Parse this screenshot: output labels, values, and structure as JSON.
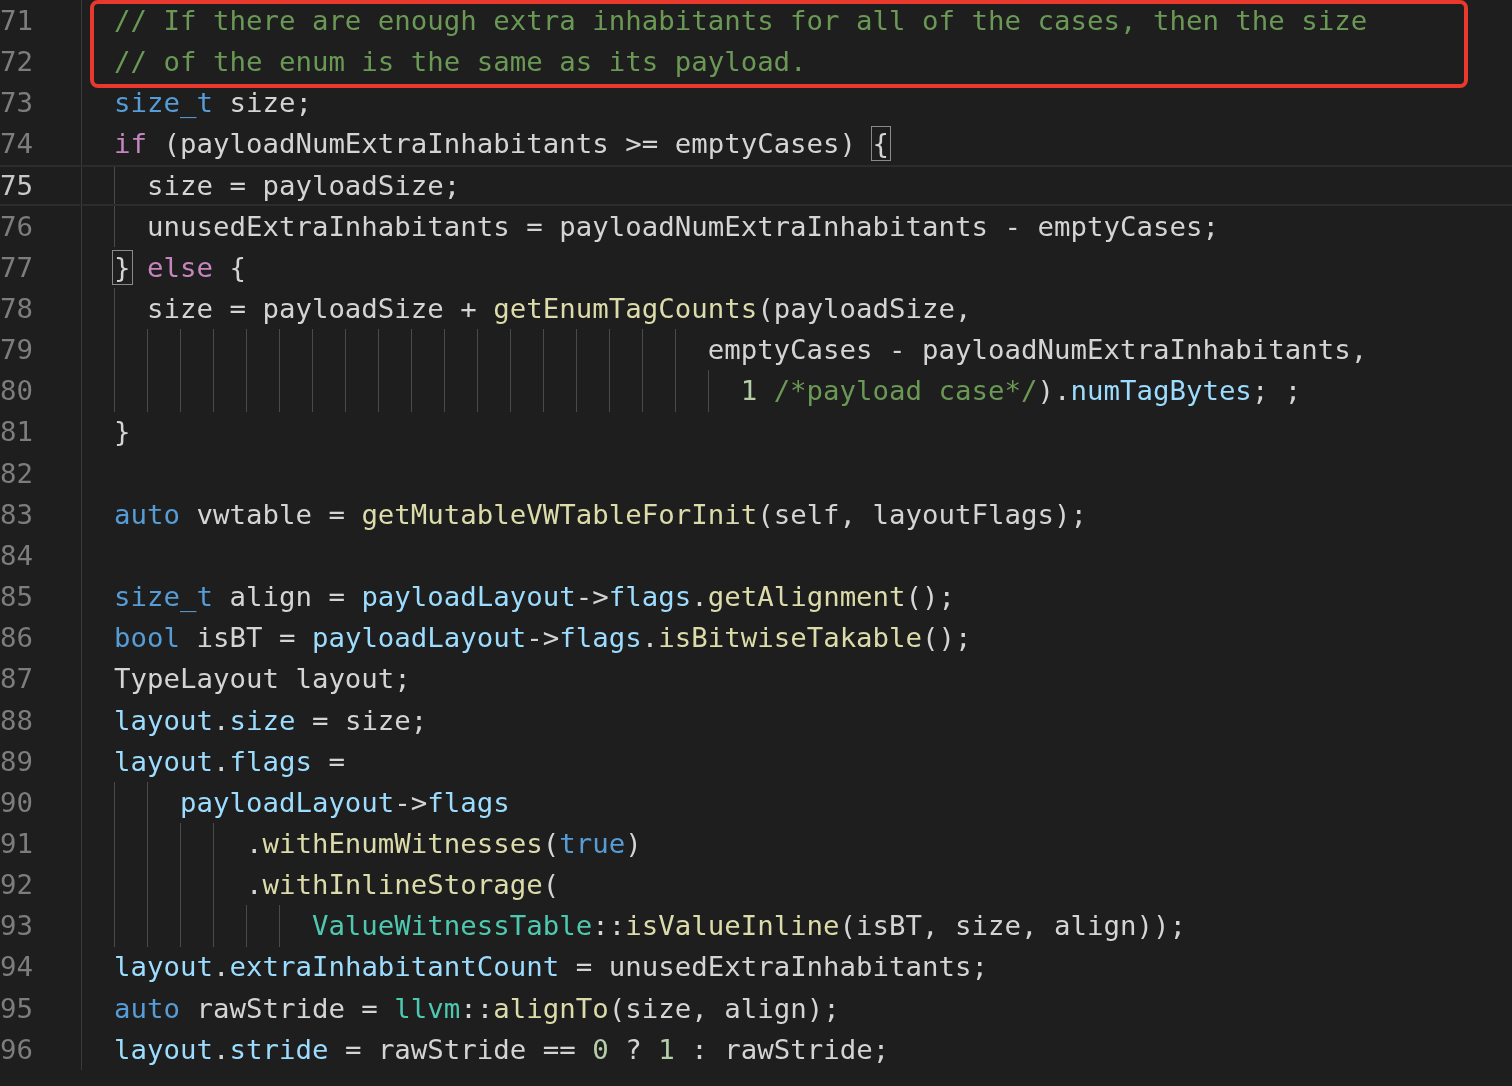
{
  "editor": {
    "lines": [
      {
        "number": "71",
        "current": false,
        "tokens": [
          {
            "kind": "comment",
            "text": "// If there are enough extra inhabitants for all of the cases, then the size"
          }
        ]
      },
      {
        "number": "72",
        "current": false,
        "tokens": [
          {
            "kind": "comment",
            "text": "// of the enum is the same as its payload."
          }
        ]
      },
      {
        "number": "73",
        "current": false,
        "tokens": [
          {
            "kind": "type",
            "text": "size_t"
          },
          {
            "kind": "plain",
            "text": " size;"
          }
        ]
      },
      {
        "number": "74",
        "current": false,
        "tokens": [
          {
            "kind": "keyword",
            "text": "if"
          },
          {
            "kind": "plain",
            "text": " (payloadNumExtraInhabitants >= emptyCases) "
          },
          {
            "kind": "bracket-match",
            "text": "{"
          }
        ]
      },
      {
        "number": "75",
        "current": true,
        "tokens": [
          {
            "kind": "plain",
            "text": "  size = payloadSize;"
          }
        ]
      },
      {
        "number": "76",
        "current": false,
        "tokens": [
          {
            "kind": "plain",
            "text": "  unusedExtraInhabitants = payloadNumExtraInhabitants - emptyCases;"
          }
        ]
      },
      {
        "number": "77",
        "current": false,
        "tokens": [
          {
            "kind": "bracket-match",
            "text": "}"
          },
          {
            "kind": "keyword",
            "text": " else"
          },
          {
            "kind": "plain",
            "text": " {"
          }
        ]
      },
      {
        "number": "78",
        "current": false,
        "tokens": [
          {
            "kind": "plain",
            "text": "  size = payloadSize + "
          },
          {
            "kind": "function",
            "text": "getEnumTagCounts"
          },
          {
            "kind": "plain",
            "text": "(payloadSize,"
          }
        ]
      },
      {
        "number": "79",
        "current": false,
        "tokens": [
          {
            "kind": "plain",
            "text": "                                    emptyCases - payloadNumExtraInhabitants,"
          }
        ]
      },
      {
        "number": "80",
        "current": false,
        "tokens": [
          {
            "kind": "number",
            "text": "                                      1"
          },
          {
            "kind": "comment",
            "text": " /*payload case*/"
          },
          {
            "kind": "plain",
            "text": ")."
          },
          {
            "kind": "variable",
            "text": "numTagBytes"
          },
          {
            "kind": "plain",
            "text": "; ;"
          }
        ]
      },
      {
        "number": "81",
        "current": false,
        "tokens": [
          {
            "kind": "plain",
            "text": "}"
          }
        ]
      },
      {
        "number": "82",
        "current": false
      },
      {
        "number": "83",
        "current": false,
        "tokens": [
          {
            "kind": "type",
            "text": "auto"
          },
          {
            "kind": "plain",
            "text": " vwtable = "
          },
          {
            "kind": "function",
            "text": "getMutableVWTableForInit"
          },
          {
            "kind": "plain",
            "text": "(self, layoutFlags);"
          }
        ]
      },
      {
        "number": "84",
        "current": false
      },
      {
        "number": "85",
        "current": false,
        "tokens": [
          {
            "kind": "type",
            "text": "size_t"
          },
          {
            "kind": "plain",
            "text": " align = "
          },
          {
            "kind": "variable",
            "text": "payloadLayout"
          },
          {
            "kind": "plain",
            "text": "->"
          },
          {
            "kind": "variable",
            "text": "flags"
          },
          {
            "kind": "plain",
            "text": "."
          },
          {
            "kind": "function",
            "text": "getAlignment"
          },
          {
            "kind": "plain",
            "text": "();"
          }
        ]
      },
      {
        "number": "86",
        "current": false,
        "tokens": [
          {
            "kind": "type",
            "text": "bool"
          },
          {
            "kind": "plain",
            "text": " isBT = "
          },
          {
            "kind": "variable",
            "text": "payloadLayout"
          },
          {
            "kind": "plain",
            "text": "->"
          },
          {
            "kind": "variable",
            "text": "flags"
          },
          {
            "kind": "plain",
            "text": "."
          },
          {
            "kind": "function",
            "text": "isBitwiseTakable"
          },
          {
            "kind": "plain",
            "text": "();"
          }
        ]
      },
      {
        "number": "87",
        "current": false,
        "tokens": [
          {
            "kind": "plain",
            "text": "TypeLayout layout;"
          }
        ]
      },
      {
        "number": "88",
        "current": false,
        "tokens": [
          {
            "kind": "variable",
            "text": "layout"
          },
          {
            "kind": "plain",
            "text": "."
          },
          {
            "kind": "variable",
            "text": "size"
          },
          {
            "kind": "plain",
            "text": " = size;"
          }
        ]
      },
      {
        "number": "89",
        "current": false,
        "tokens": [
          {
            "kind": "variable",
            "text": "layout"
          },
          {
            "kind": "plain",
            "text": "."
          },
          {
            "kind": "variable",
            "text": "flags"
          },
          {
            "kind": "plain",
            "text": " ="
          }
        ]
      },
      {
        "number": "90",
        "current": false,
        "tokens": [
          {
            "kind": "variable",
            "text": "    payloadLayout"
          },
          {
            "kind": "plain",
            "text": "->"
          },
          {
            "kind": "variable",
            "text": "flags"
          }
        ]
      },
      {
        "number": "91",
        "current": false,
        "tokens": [
          {
            "kind": "plain",
            "text": "        ."
          },
          {
            "kind": "function",
            "text": "withEnumWitnesses"
          },
          {
            "kind": "plain",
            "text": "("
          },
          {
            "kind": "type",
            "text": "true"
          },
          {
            "kind": "plain",
            "text": ")"
          }
        ]
      },
      {
        "number": "92",
        "current": false,
        "tokens": [
          {
            "kind": "plain",
            "text": "        ."
          },
          {
            "kind": "function",
            "text": "withInlineStorage"
          },
          {
            "kind": "plain",
            "text": "("
          }
        ]
      },
      {
        "number": "93",
        "current": false,
        "tokens": [
          {
            "kind": "class",
            "text": "            ValueWitnessTable"
          },
          {
            "kind": "plain",
            "text": "::"
          },
          {
            "kind": "function",
            "text": "isValueInline"
          },
          {
            "kind": "plain",
            "text": "(isBT, size, align));"
          }
        ]
      },
      {
        "number": "94",
        "current": false,
        "tokens": [
          {
            "kind": "variable",
            "text": "layout"
          },
          {
            "kind": "plain",
            "text": "."
          },
          {
            "kind": "variable",
            "text": "extraInhabitantCount"
          },
          {
            "kind": "plain",
            "text": " = unusedExtraInhabitants;"
          }
        ]
      },
      {
        "number": "95",
        "current": false,
        "tokens": [
          {
            "kind": "type",
            "text": "auto"
          },
          {
            "kind": "plain",
            "text": " rawStride = "
          },
          {
            "kind": "class",
            "text": "llvm"
          },
          {
            "kind": "plain",
            "text": "::"
          },
          {
            "kind": "function",
            "text": "alignTo"
          },
          {
            "kind": "plain",
            "text": "(size, align);"
          }
        ]
      },
      {
        "number": "96",
        "current": false,
        "tokens": [
          {
            "kind": "variable",
            "text": "layout"
          },
          {
            "kind": "plain",
            "text": "."
          },
          {
            "kind": "variable",
            "text": "stride"
          },
          {
            "kind": "plain",
            "text": " = rawStride == "
          },
          {
            "kind": "number",
            "text": "0"
          },
          {
            "kind": "plain",
            "text": " ? "
          },
          {
            "kind": "number",
            "text": "1"
          },
          {
            "kind": "plain",
            "text": " : rawStride;"
          }
        ]
      }
    ]
  }
}
